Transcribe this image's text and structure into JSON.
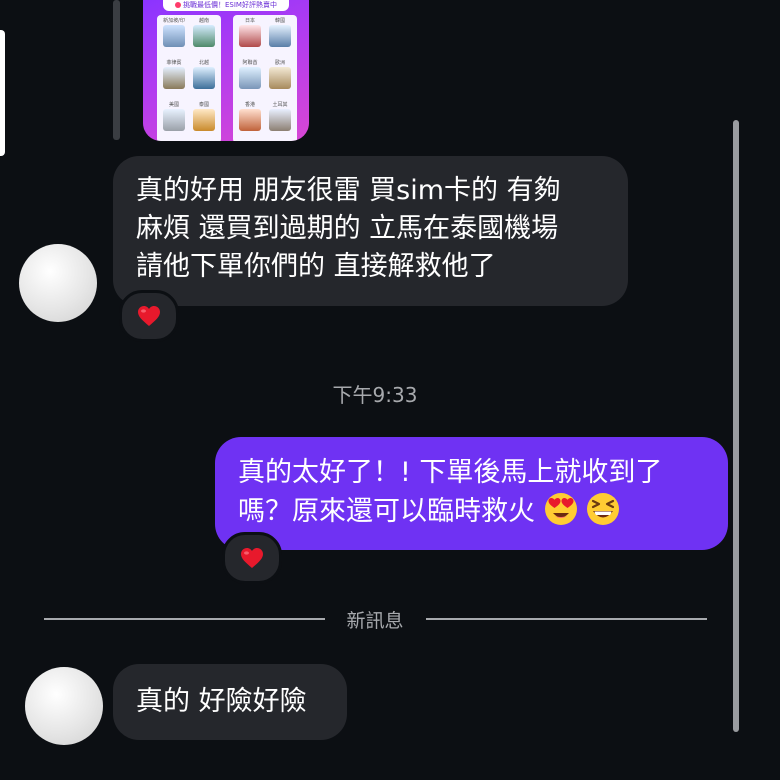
{
  "story_card": {
    "banner_text": "挑戰最低價！ESIM好評熱賣中",
    "left_panel_captions": [
      "新加坡/印",
      "越南",
      "菲律賓",
      "北越",
      "美國",
      "泰國"
    ],
    "right_panel_captions": [
      "日本",
      "韓國",
      "阿聯酋",
      "歐洲",
      "香港",
      "土耳其"
    ]
  },
  "messages": {
    "incoming_1": {
      "lines": [
        "真的好用 朋友很雷 買sim卡的 有夠",
        "麻煩 還買到過期的 立馬在泰國機場",
        "請他下單你們的 直接解救他了"
      ],
      "reaction": "heart"
    },
    "timestamp": "下午9:33",
    "outgoing_1": {
      "line1": "真的太好了！! 下單後馬上就收到了",
      "line2": "嗎？原來還可以臨時救火",
      "emojis": [
        "heart-eyes-emoji",
        "laughing-emoji"
      ],
      "reaction": "heart"
    },
    "new_messages_divider": "新訊息",
    "incoming_2": {
      "text": "真的 好險好險"
    }
  },
  "colors": {
    "background": "#0c0f13",
    "incoming_bubble": "#25272c",
    "outgoing_bubble": "#6f32f3",
    "muted_text": "#a7a9ad",
    "reaction_heart": "#e8192c"
  }
}
